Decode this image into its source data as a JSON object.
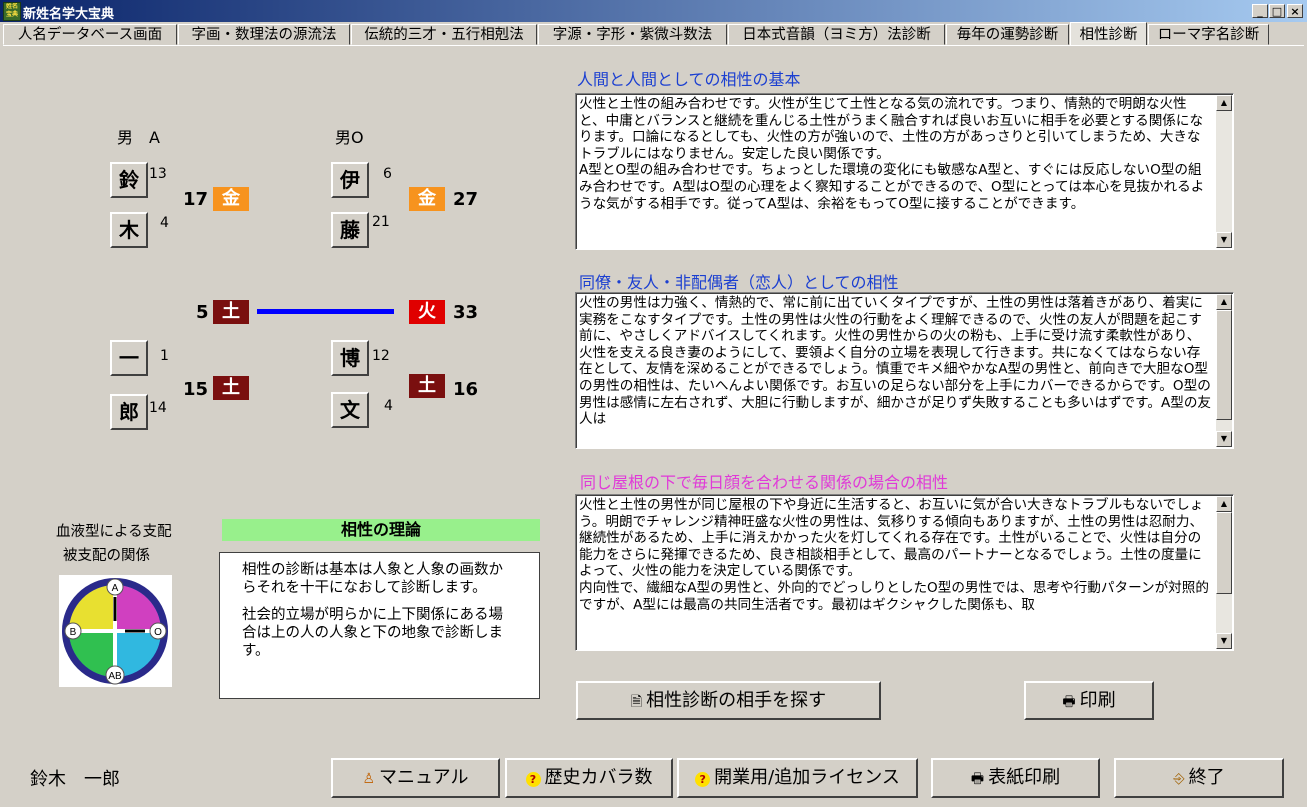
{
  "window": {
    "title": "新姓名学大宝典",
    "icon_text": "姓名宝典",
    "min_glyph": "_",
    "max_glyph": "□",
    "close_glyph": "×"
  },
  "tabs": [
    {
      "label": "人名データベース画面"
    },
    {
      "label": "字画・数理法の源流法"
    },
    {
      "label": "伝統的三才・五行相剋法"
    },
    {
      "label": "字源・字形・紫微斗数法"
    },
    {
      "label": "日本式音韻（ヨミ方）法診断"
    },
    {
      "label": "毎年の運勢診断"
    },
    {
      "label": "相性診断",
      "active": true
    },
    {
      "label": "ローマ字名診断"
    }
  ],
  "person_a": {
    "label": "男　A",
    "surname_chars": [
      {
        "char": "鈴",
        "strokes": "13"
      },
      {
        "char": "木",
        "strokes": "4"
      }
    ],
    "given_chars": [
      {
        "char": "一",
        "strokes": "1"
      },
      {
        "char": "郎",
        "strokes": "14"
      }
    ],
    "sum_top": "17",
    "element_top": "金",
    "sum_mid": "5",
    "element_mid": "土",
    "sum_bottom": "15",
    "element_bottom": "土"
  },
  "person_b": {
    "label": "男O",
    "surname_chars": [
      {
        "char": "伊",
        "strokes": "6"
      },
      {
        "char": "藤",
        "strokes": "21"
      }
    ],
    "given_chars": [
      {
        "char": "博",
        "strokes": "12"
      },
      {
        "char": "文",
        "strokes": "4"
      }
    ],
    "sum_top": "27",
    "element_top": "金",
    "sum_mid": "33",
    "element_mid": "火",
    "sum_bottom": "16",
    "element_bottom": "土"
  },
  "colors": {
    "metal": "#f7931e",
    "earth": "#7a0f0f",
    "fire": "#e00000",
    "line": "#0000ff",
    "heading_blue": "#1b3fd1",
    "heading_magenta": "#e03ad8",
    "green_band": "#98f08c"
  },
  "blood_type": {
    "caption_line1": "血液型による支配",
    "caption_line2": "被支配の関係",
    "labels": [
      "A",
      "B",
      "O",
      "AB"
    ]
  },
  "theory": {
    "title": "相性の理論",
    "para1": "相性の診断は基本は人象と人象の画数からそれを十干になおして診断します。",
    "para2": "社会的立場が明らかに上下関係にある場合は上の人の人象と下の地象で診断します。"
  },
  "sections": [
    {
      "heading": "人間と人間としての相性の基本",
      "paragraphs": [
        "火性と土性の組み合わせです。火性が生じて土性となる気の流れです。つまり、情熱的で明朗な火性と、中庸とバランスと継続を重んじる土性がうまく融合すれば良いお互いに相手を必要とする関係になります。口論になるとしても、火性の方が強いので、土性の方があっさりと引いてしまうため、大きなトラブルにはなりません。安定した良い関係です。",
        "A型とO型の組み合わせです。ちょっとした環境の変化にも敏感なA型と、すぐには反応しないO型の組み合わせです。A型はO型の心理をよく察知することができるので、O型にとっては本心を見抜かれるような気がする相手です。従ってA型は、余裕をもってO型に接することができます。"
      ]
    },
    {
      "heading": "同僚・友人・非配偶者（恋人）としての相性",
      "paragraphs": [
        "火性の男性は力強く、情熱的で、常に前に出ていくタイプですが、土性の男性は落着きがあり、着実に実務をこなすタイプです。土性の男性は火性の行動をよく理解できるので、火性の友人が問題を起こす前に、やさしくアドバイスしてくれます。火性の男性からの火の粉も、上手に受け流す柔軟性があり、火性を支える良き妻のようにして、要領よく自分の立場を表現して行きます。共になくてはならない存在として、友情を深めることができるでしょう。慎重でキメ細やかなA型の男性と、前向きで大胆なO型の男性の相性は、たいへんよい関係です。お互いの足らない部分を上手にカバーできるからです。O型の男性は感情に左右されず、大胆に行動しますが、細かさが足りず失敗することも多いはずです。A型の友人は"
      ]
    },
    {
      "heading": "同じ屋根の下で毎日顔を合わせる関係の場合の相性",
      "paragraphs": [
        "火性と土性の男性が同じ屋根の下や身近に生活すると、お互いに気が合い大きなトラブルもないでしょう。明朗でチャレンジ精神旺盛な火性の男性は、気移りする傾向もありますが、土性の男性は忍耐力、継続性があるため、上手に消えかかった火を灯してくれる存在です。土性がいることで、火性は自分の能力をさらに発揮できるため、良き相談相手として、最高のパートナーとなるでしょう。土性の度量によって、火性の能力を決定している関係です。",
        "内向性で、繊細なA型の男性と、外向的でどっしりとしたO型の男性では、思考や行動パターンが対照的ですが、A型には最高の共同生活者です。最初はギクシャクした関係も、取"
      ]
    }
  ],
  "action_buttons": {
    "find_partner": "相性診断の相手を探す",
    "print": "印刷"
  },
  "footer": {
    "name": "鈴木　一郎",
    "manual": "マニュアル",
    "history": "歴史カバラ数",
    "license": "開業用/追加ライセンス",
    "cover_print": "表紙印刷",
    "exit": "終了"
  }
}
